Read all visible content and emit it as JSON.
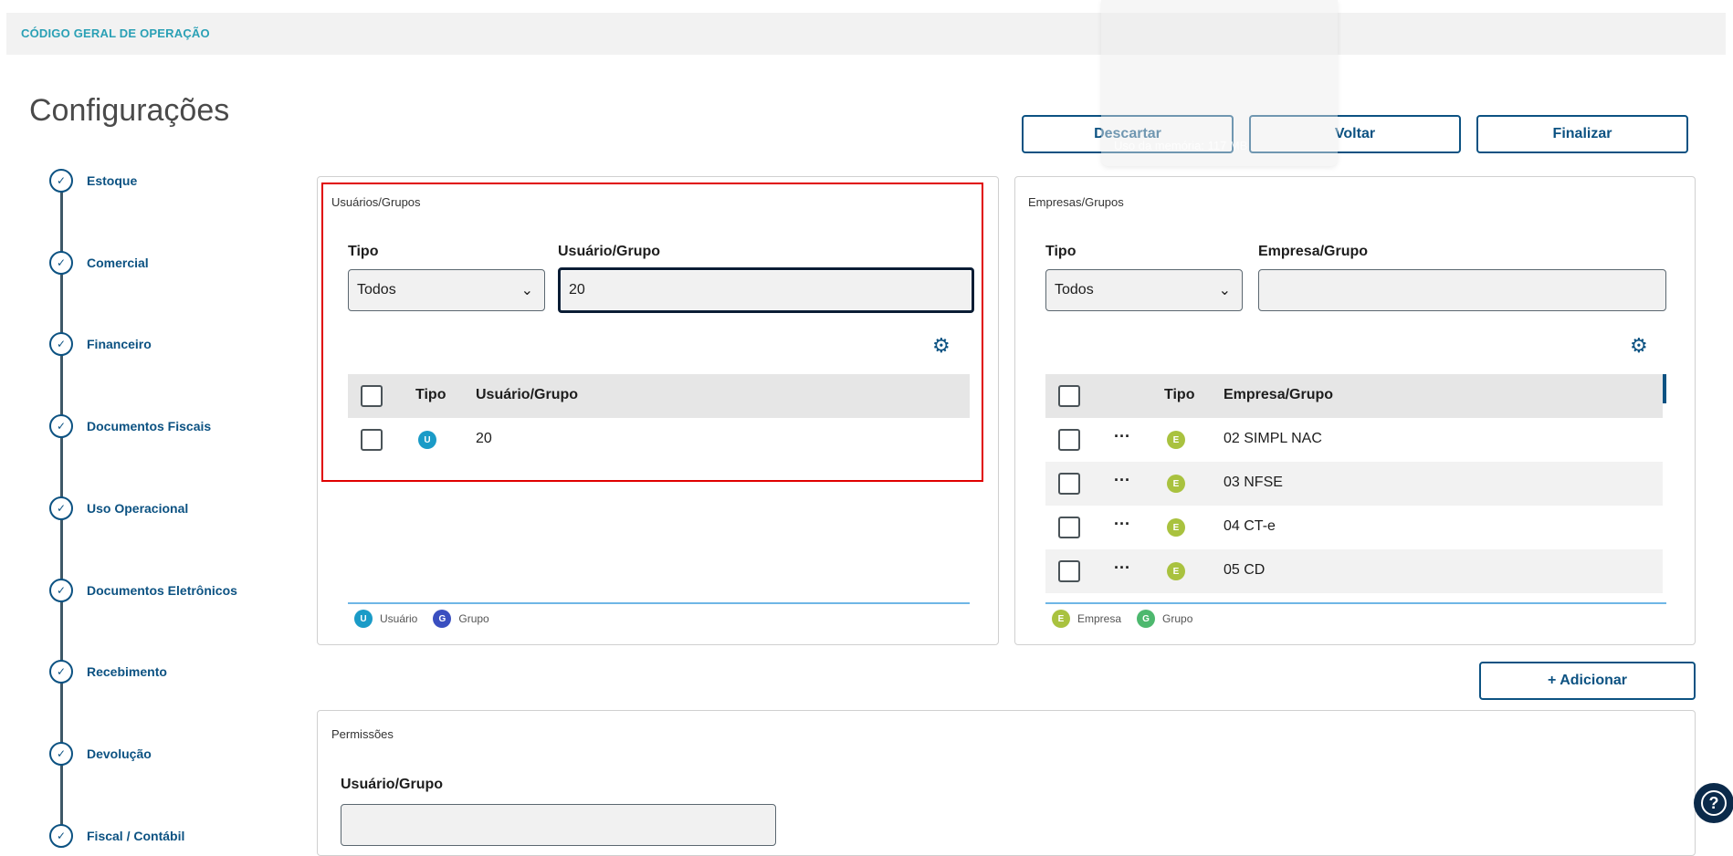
{
  "header": {
    "title": "CÓDIGO GERAL DE OPERAÇÃO"
  },
  "page_title": "Configurações",
  "actions": {
    "discard": "Descartar",
    "back": "Voltar",
    "finish": "Finalizar",
    "add": "+ Adicionar"
  },
  "steps": [
    "Estoque",
    "Comercial",
    "Financeiro",
    "Documentos Fiscais",
    "Uso Operacional",
    "Documentos Eletrônicos",
    "Recebimento",
    "Devolução",
    "Fiscal / Contábil"
  ],
  "users_panel": {
    "title": "Usuários/Grupos",
    "tipo_label": "Tipo",
    "tipo_value": "Todos",
    "search_label": "Usuário/Grupo",
    "search_value": "20",
    "columns": [
      "Tipo",
      "Usuário/Grupo"
    ],
    "rows": [
      {
        "badge": "U",
        "name": "20"
      }
    ],
    "legend": [
      {
        "badge": "U",
        "label": "Usuário"
      },
      {
        "badge": "G",
        "label": "Grupo"
      }
    ]
  },
  "companies_panel": {
    "title": "Empresas/Grupos",
    "tipo_label": "Tipo",
    "tipo_value": "Todos",
    "search_label": "Empresa/Grupo",
    "search_value": "",
    "columns": [
      "Tipo",
      "Empresa/Grupo"
    ],
    "rows": [
      {
        "badge": "E",
        "name": "02 SIMPL NAC"
      },
      {
        "badge": "E",
        "name": "03 NFSE"
      },
      {
        "badge": "E",
        "name": "04 CT-e"
      },
      {
        "badge": "E",
        "name": "05 CD"
      }
    ],
    "legend": [
      {
        "badge": "E",
        "label": "Empresa"
      },
      {
        "badge": "G",
        "label": "Grupo"
      }
    ]
  },
  "permissions": {
    "title": "Permissões",
    "field_label": "Usuário/Grupo"
  },
  "overlay": {
    "memory": "Uso da memória: 117 MB"
  },
  "colors": {
    "primary": "#0c5282",
    "accent": "#2aa0b5",
    "user": "#1a9bc7",
    "group_user": "#3a4fc0",
    "company": "#a9c23f",
    "group_company": "#4db86e",
    "highlight": "#e00000"
  }
}
